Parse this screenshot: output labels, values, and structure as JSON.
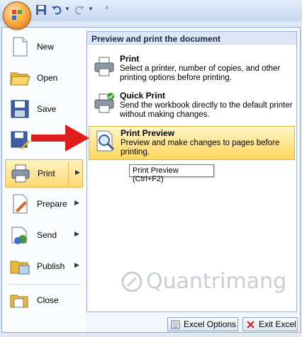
{
  "colors": {
    "accent": "#ffd870",
    "menu_border": "#8eaacf",
    "arrow": "#e01d1d"
  },
  "left_menu": {
    "items": [
      {
        "label": "New",
        "icon": "new-document-icon"
      },
      {
        "label": "Open",
        "icon": "open-folder-icon"
      },
      {
        "label": "Save",
        "icon": "floppy-disk-icon"
      },
      {
        "label": "",
        "icon": "save-as-icon"
      },
      {
        "label": "Print",
        "icon": "printer-icon",
        "selected": true
      },
      {
        "label": "Prepare",
        "icon": "prepare-icon"
      },
      {
        "label": "Send",
        "icon": "send-icon"
      },
      {
        "label": "Publish",
        "icon": "publish-icon"
      },
      {
        "label": "Close",
        "icon": "close-folder-icon"
      }
    ]
  },
  "submenu": {
    "title": "Preview and print the document",
    "options": [
      {
        "title": "Print",
        "description": "Select a printer, number of copies, and other printing options before printing."
      },
      {
        "title": "Quick Print",
        "description": "Send the workbook directly to the default printer without making changes."
      },
      {
        "title": "Print Preview",
        "description": "Preview and make changes to pages before printing.",
        "highlighted": true
      }
    ]
  },
  "tooltip": "Print Preview (Ctrl+F2)",
  "footer": {
    "options_label": "Excel Options",
    "exit_label": "Exit Excel"
  },
  "watermark": "Quantrimang"
}
